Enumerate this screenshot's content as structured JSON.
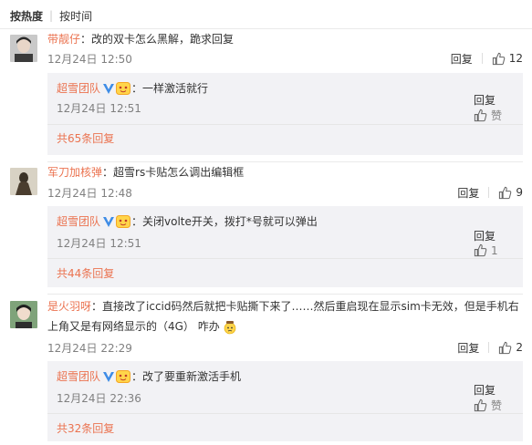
{
  "sort": {
    "by_hot": "按热度",
    "by_time": "按时间"
  },
  "reply_label": "回复",
  "like_label": "赞",
  "comments": [
    {
      "user": "带靓仔",
      "text": "：改的双卡怎么黑解，跪求回复",
      "time": "12月24日 12:50",
      "likes": "12",
      "reply": {
        "user": "超雪团队",
        "text": "：一样激活就行",
        "time": "12月24日 12:51",
        "likes": "赞"
      },
      "more": "共65条回复"
    },
    {
      "user": "军刀加核弹",
      "text": "：超雪rs卡贴怎么调出编辑框",
      "time": "12月24日 12:48",
      "likes": "9",
      "reply": {
        "user": "超雪团队",
        "text": "：关闭volte开关，拨打*号就可以弹出",
        "time": "12月24日 12:51",
        "likes": "1"
      },
      "more": "共44条回复"
    },
    {
      "user": "是火羽呀",
      "text_line1": "：直接改了iccid码然后就把卡贴撕下来了……然后重启现在显示sim卡无效，但是手机右",
      "text_line2": "上角又是有网络显示的（4G） 咋办",
      "time": "12月24日 22:29",
      "likes": "2",
      "reply": {
        "user": "超雪团队",
        "text": "：改了要重新激活手机",
        "time": "12月24日 22:36",
        "likes": "赞"
      },
      "more": "共32条回复"
    }
  ],
  "colors": {
    "link": "#eb7350",
    "reply_bg": "#f2f2f5",
    "verified": "#3e8ce6",
    "fan_badge": "#f5a623"
  }
}
